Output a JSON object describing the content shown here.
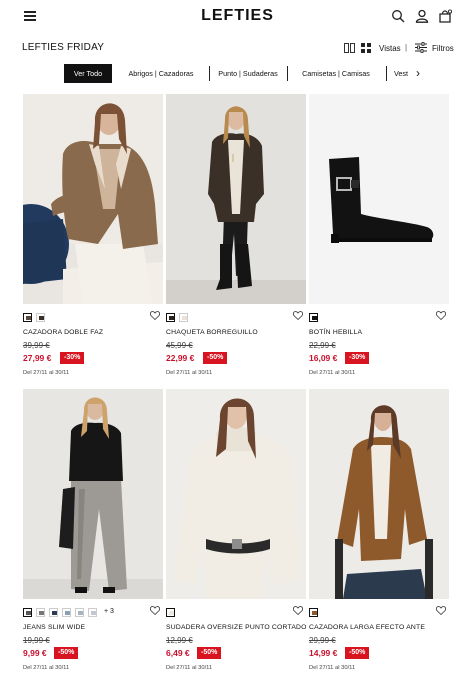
{
  "header": {
    "logo": "LEFTIES",
    "icons": [
      "menu-icon",
      "search-icon",
      "user-icon",
      "shopping-bag-icon"
    ]
  },
  "toolbar": {
    "title": "LEFTIES FRIDAY",
    "views_label": "Vistas",
    "separator": "|",
    "filters_label": "Filtros"
  },
  "tabs": [
    {
      "label": "Ver Todo",
      "active": true
    },
    {
      "label": "Abrigos | Cazadoras",
      "active": false
    },
    {
      "label": "Punto | Sudaderas",
      "active": false
    },
    {
      "label": "Camisetas | Camisas",
      "active": false
    },
    {
      "label": "Vest",
      "active": false
    }
  ],
  "colors": {
    "discount": "#d7141f",
    "price": "#c8102e",
    "accent": "#111111"
  },
  "products": [
    {
      "name": "CAZADORA DOBLE FAZ",
      "old_price": "39,99 €",
      "price": "27,99 €",
      "discount": "-30%",
      "dates": "Del 27/11 al 30/11",
      "swatches": [
        "#5a4a3e",
        "#3b2e28"
      ],
      "more_colors": ""
    },
    {
      "name": "CHAQUETA BORREGUILLO",
      "old_price": "45,99 €",
      "price": "22,99 €",
      "discount": "-50%",
      "dates": "Del 27/11 al 30/11",
      "swatches": [
        "#2b241e",
        "#e9e2d6"
      ],
      "more_colors": ""
    },
    {
      "name": "BOTÍN HEBILLA",
      "old_price": "22,99 €",
      "price": "16,09 €",
      "discount": "-30%",
      "dates": "Del 27/11 al 30/11",
      "swatches": [
        "#111111"
      ],
      "more_colors": ""
    },
    {
      "name": "JEANS SLIM WIDE",
      "old_price": "19,99 €",
      "price": "9,99 €",
      "discount": "-50%",
      "dates": "Del 27/11 al 30/11",
      "swatches": [
        "#555555",
        "#777777",
        "#2a3b52",
        "#8aa0b4",
        "#a6b4c2",
        "#c2c8ce"
      ],
      "more_colors": "+ 3"
    },
    {
      "name": "SUDADERA OVERSIZE PUNTO CORTADO",
      "old_price": "12,99 €",
      "price": "6,49 €",
      "discount": "-50%",
      "dates": "Del 27/11 al 30/11",
      "swatches": [
        "#ece8df"
      ],
      "more_colors": ""
    },
    {
      "name": "CAZADORA LARGA EFECTO ANTE",
      "old_price": "29,99 €",
      "price": "14,99 €",
      "discount": "-50%",
      "dates": "Del 27/11 al 30/11",
      "swatches": [
        "#8a5a2e"
      ],
      "more_colors": ""
    }
  ]
}
